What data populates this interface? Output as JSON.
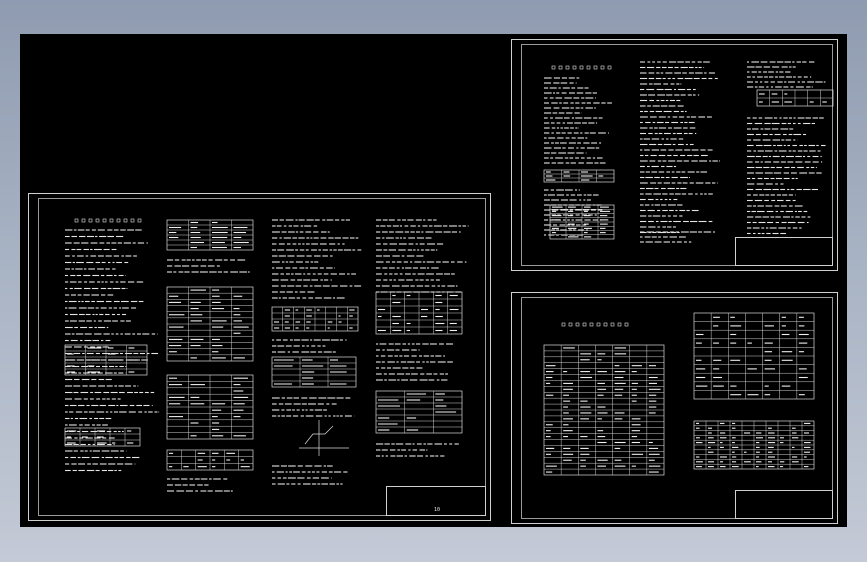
{
  "app": {
    "background_gradient": [
      "#8f9bb0",
      "#c4cad6"
    ],
    "drawing_background": "#000000",
    "line_color": "#e6e6e6"
  },
  "sheets": [
    {
      "id": "sheet-1",
      "title_block": {
        "name": "",
        "scale": "",
        "dwg_no": "10"
      }
    },
    {
      "id": "sheet-2",
      "title_block": {
        "name": "",
        "scale": "",
        "dwg_no": ""
      }
    },
    {
      "id": "sheet-3",
      "title_block": {
        "name": "",
        "scale": "",
        "dwg_no": ""
      }
    }
  ]
}
